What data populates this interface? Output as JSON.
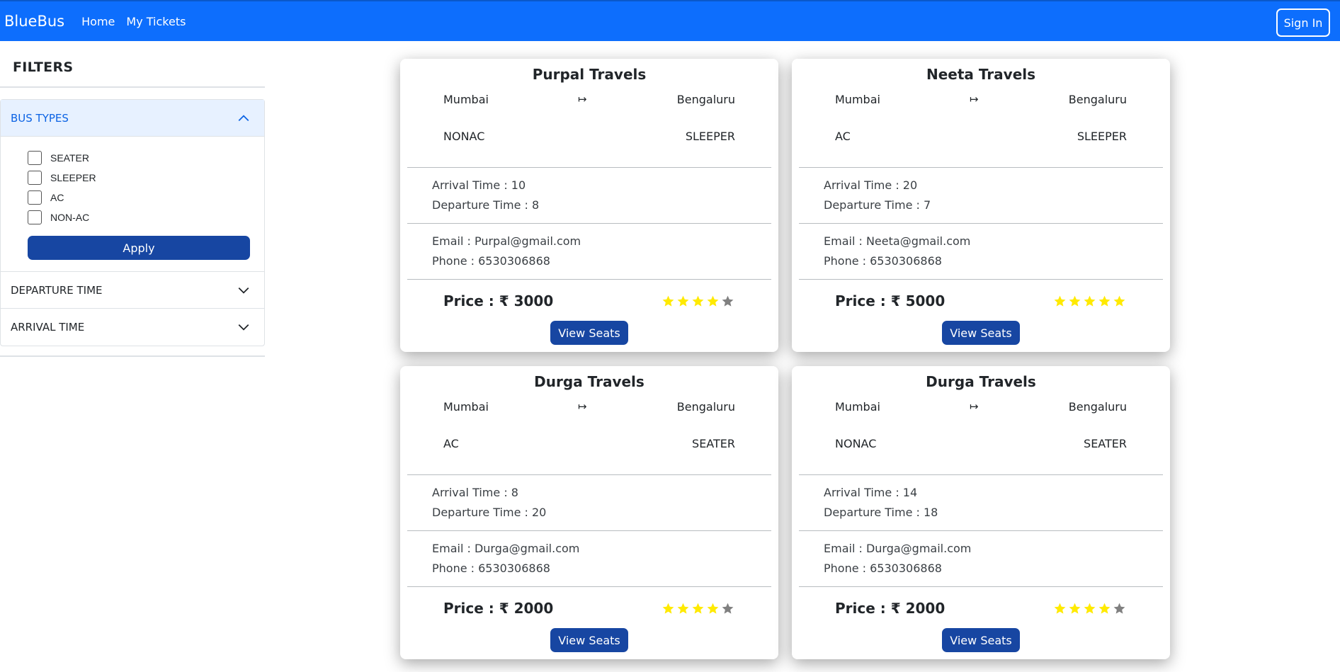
{
  "navbar": {
    "brand": "BlueBus",
    "links": [
      "Home",
      "My Tickets"
    ],
    "sign_in": "Sign In"
  },
  "sidebar": {
    "title": "FILTERS",
    "sections": {
      "bus_types": {
        "label": "BUS TYPES",
        "options": [
          "SEATER",
          "SLEEPER",
          "AC",
          "NON-AC"
        ],
        "apply": "Apply"
      },
      "departure": {
        "label": "DEPARTURE TIME"
      },
      "arrival": {
        "label": "ARRIVAL TIME"
      }
    }
  },
  "cards": [
    {
      "name": "Purpal Travels",
      "from": "Mumbai",
      "arrow": "↦",
      "to": "Bengaluru",
      "ac": "NONAC",
      "seat": "SLEEPER",
      "arrival": "Arrival Time : 10",
      "departure": "Departure Time : 8",
      "email": "Email : Purpal@gmail.com",
      "phone": "Phone : 6530306868",
      "price": "Price : ₹ 3000",
      "rating": 4,
      "button": "View Seats"
    },
    {
      "name": "Neeta Travels",
      "from": "Mumbai",
      "arrow": "↦",
      "to": "Bengaluru",
      "ac": "AC",
      "seat": "SLEEPER",
      "arrival": "Arrival Time : 20",
      "departure": "Departure Time : 7",
      "email": "Email : Neeta@gmail.com",
      "phone": "Phone : 6530306868",
      "price": "Price : ₹ 5000",
      "rating": 5,
      "button": "View Seats"
    },
    {
      "name": "Durga Travels",
      "from": "Mumbai",
      "arrow": "↦",
      "to": "Bengaluru",
      "ac": "AC",
      "seat": "SEATER",
      "arrival": "Arrival Time : 8",
      "departure": "Departure Time : 20",
      "email": "Email : Durga@gmail.com",
      "phone": "Phone : 6530306868",
      "price": "Price : ₹ 2000",
      "rating": 4,
      "button": "View Seats"
    },
    {
      "name": "Durga Travels",
      "from": "Mumbai",
      "arrow": "↦",
      "to": "Bengaluru",
      "ac": "NONAC",
      "seat": "SEATER",
      "arrival": "Arrival Time : 14",
      "departure": "Departure Time : 18",
      "email": "Email : Durga@gmail.com",
      "phone": "Phone : 6530306868",
      "price": "Price : ₹ 2000",
      "rating": 4,
      "button": "View Seats"
    }
  ],
  "colors": {
    "navbar": "#0d6efd",
    "button": "#1746a2",
    "star_filled": "#ffea00",
    "star_empty": "#808080"
  },
  "icons": {
    "expanded": "chevron-up-icon",
    "collapsed": "chevron-down-icon",
    "rating": "star-icon"
  }
}
